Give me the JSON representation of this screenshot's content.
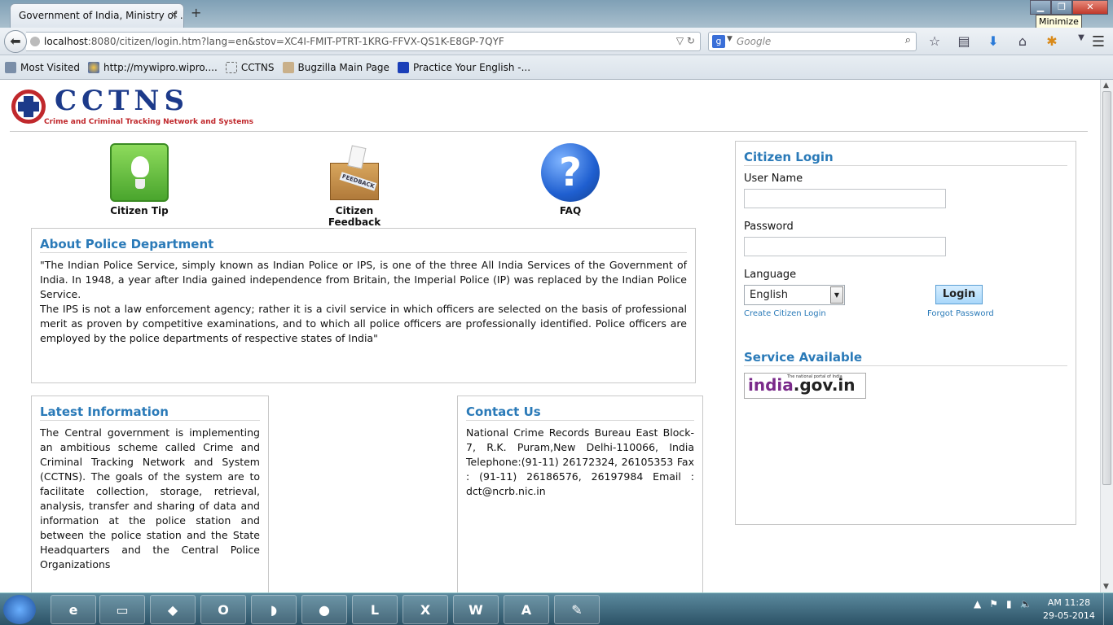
{
  "browser": {
    "tab_title": "Government of India, Ministry of ...",
    "tab_close": "×",
    "new_tab": "+",
    "url_host": "localhost",
    "url_rest": ":8080/citizen/login.htm?lang=en&stov=XC4I-FMIT-PTRT-1KRG-FFVX-QS1K-E8GP-7QYF",
    "search_placeholder": "Google",
    "search_engine": "g",
    "tooltip": "Minimize",
    "bookmarks": [
      "Most Visited",
      "http://mywipro.wipro....",
      "CCTNS",
      "Bugzilla Main Page",
      "Practice Your English -..."
    ]
  },
  "site": {
    "logo_title": "CCTNS",
    "logo_subtitle": "Crime and Criminal Tracking Network and Systems"
  },
  "quick_links": {
    "tip": "Citizen Tip",
    "feedback": "Citizen Feedback",
    "feedback_label": "FEEDBACK",
    "faq": "FAQ",
    "faq_glyph": "?"
  },
  "about": {
    "title": "About Police Department",
    "p1": "\"The Indian Police Service, simply known as Indian Police or IPS, is one of the three All India Services of the Government of India. In 1948, a year after India gained independence from Britain, the Imperial Police (IP) was replaced by the Indian Police Service.",
    "p2": "The IPS is not a law enforcement agency; rather it is a civil service in which officers are selected on the basis of professional merit as proven by competitive examinations, and to which all police officers are professionally identified. Police officers are employed by the police departments of respective states of India\""
  },
  "latest": {
    "title": "Latest Information",
    "text": "The Central government is implementing an ambitious scheme called Crime and Criminal Tracking Network and System (CCTNS). The goals of the system are to facilitate collection, storage, retrieval, analysis, transfer and sharing of data and information at the police station and between the police station and the State Headquarters and the Central Police Organizations"
  },
  "contact": {
    "title": "Contact Us",
    "text": "National Crime Records Bureau East Block-7, R.K. Puram,New Delhi-110066, India Telephone:(91-11) 26172324, 26105353 Fax : (91-11) 26186576, 26197984 Email : dct@ncrb.nic.in"
  },
  "login": {
    "title": "Citizen Login",
    "username_label": "User Name",
    "username_value": "",
    "password_label": "Password",
    "password_value": "",
    "language_label": "Language",
    "language_value": "English",
    "login_button": "Login",
    "create_link": "Create Citizen Login",
    "forgot_link": "Forgot Password",
    "service_title": "Service Available",
    "india_logo_part1": "india",
    "india_logo_part2": ".gov.in",
    "india_logo_tag": "The national portal of India"
  },
  "taskbar": {
    "clock_time": "AM 11:28",
    "clock_date": "29-05-2014"
  }
}
